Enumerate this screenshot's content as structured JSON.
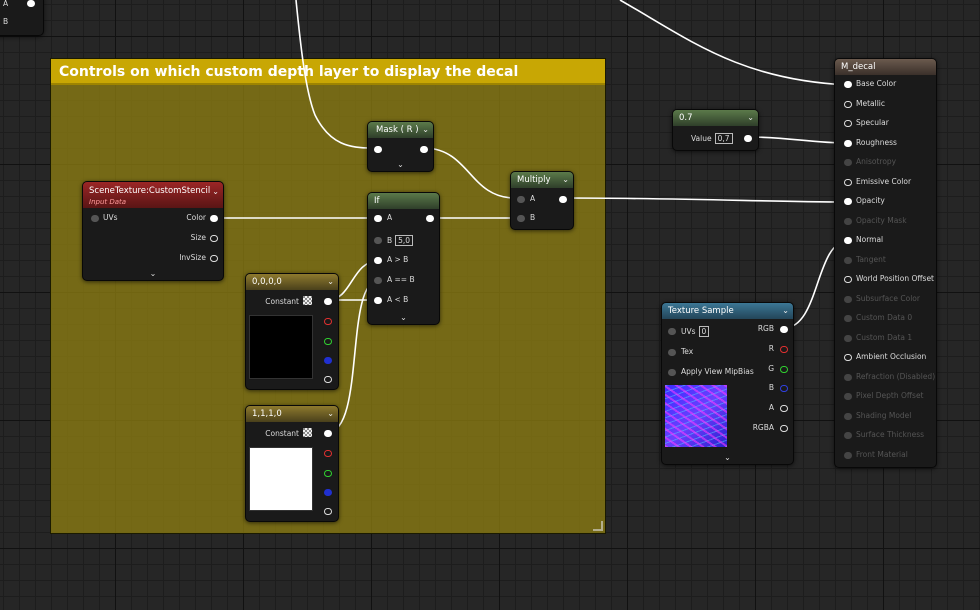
{
  "comment": {
    "title": "Controls on which custom depth layer to display the decal"
  },
  "top_left_node": {
    "pins": [
      "A",
      "B"
    ]
  },
  "mask_node": {
    "title": "Mask ( R )",
    "expand": "⌄"
  },
  "if_node": {
    "title": "If",
    "pins": {
      "a": "A",
      "b": "B",
      "b_value": "5,0",
      "a_gt_b": "A > B",
      "a_eq_b": "A == B",
      "a_lt_b": "A < B"
    },
    "expand": "⌄"
  },
  "multiply_node": {
    "title": "Multiply",
    "pins": {
      "a": "A",
      "b": "B"
    }
  },
  "scene_texture_node": {
    "title": "SceneTexture:CustomStencil",
    "subtitle": "Input Data",
    "pins": {
      "uvs": "UVs",
      "color": "Color",
      "size": "Size",
      "invsize": "InvSize"
    },
    "expand": "⌄"
  },
  "constant_black": {
    "title": "0,0,0,0",
    "label": "Constant",
    "color": "#000000"
  },
  "constant_white": {
    "title": "1,1,1,0",
    "label": "Constant",
    "color": "#ffffff"
  },
  "scalar_node": {
    "title": "0.7",
    "label": "Value",
    "value": "0,7"
  },
  "texture_node": {
    "title": "Texture Sample",
    "pins": {
      "uvs": "UVs",
      "uvs_value": "0",
      "tex": "Tex",
      "mip": "Apply View MipBias",
      "rgb": "RGB",
      "r": "R",
      "g": "G",
      "b": "B",
      "a": "A",
      "rgba": "RGBA"
    },
    "expand": "⌄"
  },
  "material_node": {
    "title": "M_decal",
    "inputs": [
      {
        "label": "Base Color",
        "active": true
      },
      {
        "label": "Metallic",
        "active": true
      },
      {
        "label": "Specular",
        "active": true
      },
      {
        "label": "Roughness",
        "active": true
      },
      {
        "label": "Anisotropy",
        "active": false
      },
      {
        "label": "Emissive Color",
        "active": true
      },
      {
        "label": "Opacity",
        "active": true
      },
      {
        "label": "Opacity Mask",
        "active": false
      },
      {
        "label": "Normal",
        "active": true
      },
      {
        "label": "Tangent",
        "active": false
      },
      {
        "label": "World Position Offset",
        "active": true
      },
      {
        "label": "Subsurface Color",
        "active": false
      },
      {
        "label": "Custom Data 0",
        "active": false
      },
      {
        "label": "Custom Data 1",
        "active": false
      },
      {
        "label": "Ambient Occlusion",
        "active": true
      },
      {
        "label": "Refraction (Disabled)",
        "active": false
      },
      {
        "label": "Pixel Depth Offset",
        "active": false
      },
      {
        "label": "Shading Model",
        "active": false
      },
      {
        "label": "Surface Thickness",
        "active": false
      },
      {
        "label": "Front Material",
        "active": false
      }
    ]
  },
  "colors": {
    "grid_bg": "#262626",
    "comment_bg": "#8c7c12",
    "comment_header": "#c8a704",
    "wire": "#ffffff"
  }
}
